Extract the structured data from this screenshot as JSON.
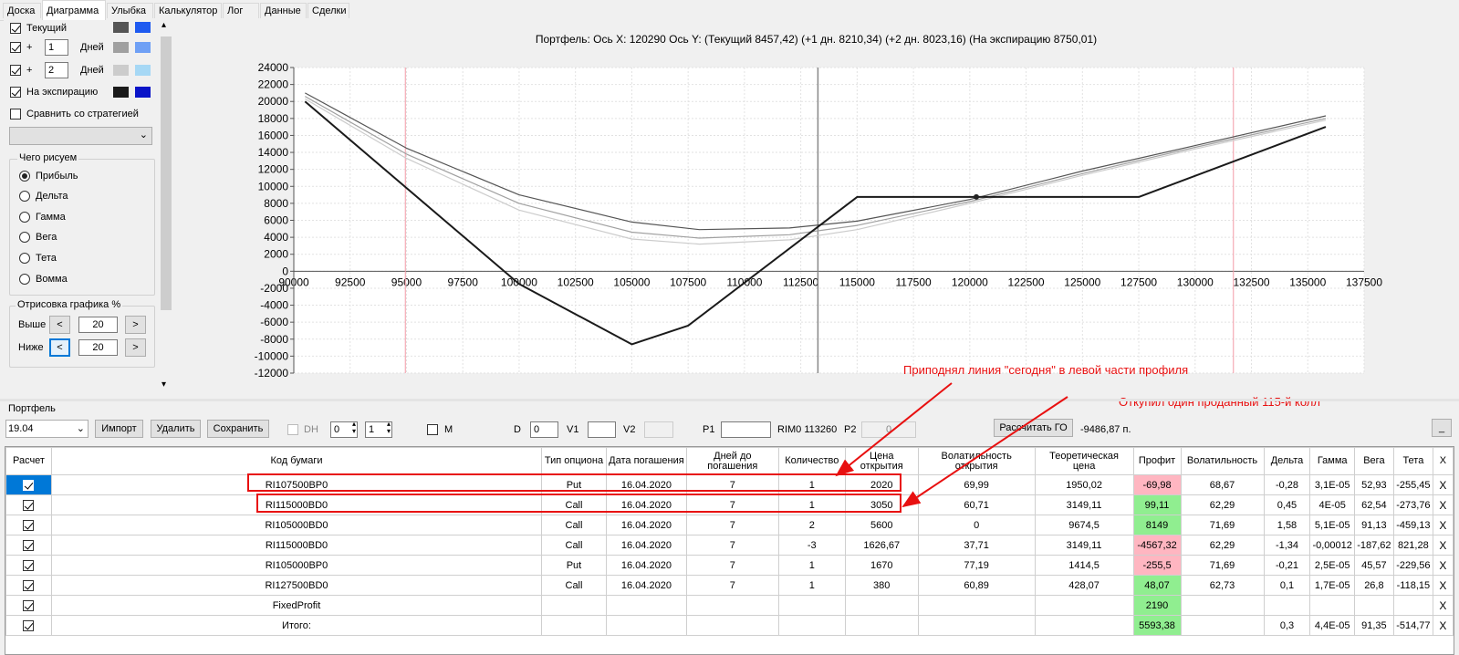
{
  "tabs": [
    "Доска",
    "Диаграмма",
    "Улыбка",
    "Калькулятор",
    "Лог",
    "Данные",
    "Сделки"
  ],
  "active_tab": 1,
  "left_panel": {
    "current_label": "Текущий",
    "plus1_sign": "+",
    "plus1_days": "1",
    "plus1_unit": "Дней",
    "plus2_sign": "+",
    "plus2_days": "2",
    "plus2_unit": "Дней",
    "expiry_label": "На экспирацию",
    "compare_label": "Сравнить со стратегией",
    "what_draw_title": "Чего рисуем",
    "radios": [
      "Прибыль",
      "Дельта",
      "Гамма",
      "Вега",
      "Тета",
      "Вомма"
    ],
    "selected_radio": 0,
    "render_title": "Отрисовка графика %",
    "above_label": "Выше",
    "above_value": "20",
    "below_label": "Ниже",
    "below_value": "20",
    "swatches": {
      "current": [
        "#555555",
        "#1e5af0"
      ],
      "plus1": [
        "#a0a0a0",
        "#6fa0f5"
      ],
      "plus2": [
        "#cccccc",
        "#a6d8f5"
      ],
      "expiry": [
        "#1a1a1a",
        "#0a14c8"
      ]
    }
  },
  "chart_header": "Портфель: Ось X: 120290 Ось Y:  (Текущий 8457,42)  (+1 дн. 8210,34)  (+2 дн. 8023,16)  (На экспирацию 8750,01)",
  "chart_data": {
    "type": "line",
    "xlim": [
      90000,
      137500
    ],
    "ylim": [
      -12000,
      24000
    ],
    "x_ticks": [
      "90000",
      "92500",
      "95000",
      "97500",
      "100000",
      "102500",
      "105000",
      "107500",
      "110000",
      "112500",
      "115000",
      "117500",
      "120000",
      "122500",
      "125000",
      "127500",
      "130000",
      "132500",
      "135000",
      "137500"
    ],
    "y_ticks": [
      "24000",
      "22000",
      "20000",
      "18000",
      "16000",
      "14000",
      "12000",
      "10000",
      "8000",
      "6000",
      "4000",
      "2000",
      "0",
      "-2000",
      "-4000",
      "-6000",
      "-8000",
      "-10000",
      "-12000"
    ],
    "grid": true,
    "cursor_x": 113260,
    "red_lines_x": [
      94950,
      131700
    ],
    "marker": {
      "x": 120290,
      "y": 8750
    },
    "series": [
      {
        "color": "#1a1a1a",
        "points": [
          [
            90500,
            20000
          ],
          [
            100000,
            -1500
          ],
          [
            105000,
            -8600
          ],
          [
            107500,
            -6400
          ],
          [
            115000,
            8750
          ],
          [
            127500,
            8750
          ],
          [
            135800,
            17000
          ]
        ]
      },
      {
        "color": "#555555",
        "points": [
          [
            90500,
            21000
          ],
          [
            95000,
            14500
          ],
          [
            100000,
            9000
          ],
          [
            105000,
            5800
          ],
          [
            108000,
            4900
          ],
          [
            112000,
            5100
          ],
          [
            115000,
            5900
          ],
          [
            120000,
            8450
          ],
          [
            125000,
            11800
          ],
          [
            130000,
            14800
          ],
          [
            135800,
            18300
          ]
        ]
      },
      {
        "color": "#a0a0a0",
        "points": [
          [
            90500,
            20600
          ],
          [
            95000,
            13800
          ],
          [
            100000,
            8000
          ],
          [
            105000,
            4600
          ],
          [
            108000,
            3900
          ],
          [
            112000,
            4300
          ],
          [
            115000,
            5400
          ],
          [
            120000,
            8200
          ],
          [
            125000,
            11500
          ],
          [
            130000,
            14600
          ],
          [
            135800,
            18000
          ]
        ]
      },
      {
        "color": "#cccccc",
        "points": [
          [
            90500,
            20300
          ],
          [
            95000,
            13300
          ],
          [
            100000,
            7200
          ],
          [
            105000,
            3800
          ],
          [
            108000,
            3200
          ],
          [
            112000,
            3700
          ],
          [
            115000,
            4900
          ],
          [
            120000,
            8000
          ],
          [
            125000,
            11300
          ],
          [
            130000,
            14400
          ],
          [
            135800,
            17800
          ]
        ]
      }
    ]
  },
  "annotations": {
    "today_line": "Приподнял линия \"сегодня\" в левой части профиля",
    "bought_call": "Откупил один проданный 115-й колл"
  },
  "portfolio": {
    "title": "Портфель",
    "portfolio_select": "19.04",
    "import": "Импорт",
    "delete": "Удалить",
    "save": "Сохранить",
    "dh_label": "DH",
    "dh_val1": "0",
    "dh_val2": "1",
    "m_label": "M",
    "d_label": "D",
    "d_value": "0",
    "v1_label": "V1",
    "v2_label": "V2",
    "p1_label": "P1",
    "rim_label": "RIM0 113260",
    "p2_label": "P2",
    "p2_value": "0",
    "calc_go": "Рассчитать ГО",
    "go_value": "-9486,87 п.",
    "underscore": "_"
  },
  "table": {
    "headers": [
      "Расчет",
      "Код бумаги",
      "Тип опциона",
      "Дата погашения",
      "Дней до погашения",
      "Количество",
      "Цена открытия",
      "Волатильность открытия",
      "Теоретическая цена",
      "Профит",
      "Волатильность",
      "Дельта",
      "Гамма",
      "Вега",
      "Тета",
      "X"
    ],
    "rows": [
      [
        "RI107500BP0",
        "Put",
        "16.04.2020",
        "7",
        "1",
        "2020",
        "69,99",
        "1950,02",
        "-69,98",
        "68,67",
        "-0,28",
        "3,1E-05",
        "52,93",
        "-255,45",
        "X"
      ],
      [
        "RI115000BD0",
        "Call",
        "16.04.2020",
        "7",
        "1",
        "3050",
        "60,71",
        "3149,11",
        "99,11",
        "62,29",
        "0,45",
        "4E-05",
        "62,54",
        "-273,76",
        "X"
      ],
      [
        "RI105000BD0",
        "Call",
        "16.04.2020",
        "7",
        "2",
        "5600",
        "0",
        "9674,5",
        "8149",
        "71,69",
        "1,58",
        "5,1E-05",
        "91,13",
        "-459,13",
        "X"
      ],
      [
        "RI115000BD0",
        "Call",
        "16.04.2020",
        "7",
        "-3",
        "1626,67",
        "37,71",
        "3149,11",
        "-4567,32",
        "62,29",
        "-1,34",
        "-0,00012",
        "-187,62",
        "821,28",
        "X"
      ],
      [
        "RI105000BP0",
        "Put",
        "16.04.2020",
        "7",
        "1",
        "1670",
        "77,19",
        "1414,5",
        "-255,5",
        "71,69",
        "-0,21",
        "2,5E-05",
        "45,57",
        "-229,56",
        "X"
      ],
      [
        "RI127500BD0",
        "Call",
        "16.04.2020",
        "7",
        "1",
        "380",
        "60,89",
        "428,07",
        "48,07",
        "62,73",
        "0,1",
        "1,7E-05",
        "26,8",
        "-118,15",
        "X"
      ],
      [
        "FixedProfit",
        "",
        "",
        "",
        "",
        "",
        "",
        "",
        "2190",
        "",
        "",
        "",
        "",
        "",
        "X"
      ],
      [
        "Итого:",
        "",
        "",
        "",
        "",
        "",
        "",
        "",
        "5593,38",
        "",
        "0,3",
        "4,4E-05",
        "91,35",
        "-514,77",
        "X"
      ]
    ],
    "profit_sign": [
      "neg",
      "pos",
      "pos",
      "neg",
      "neg",
      "pos",
      "pos",
      "pos"
    ]
  }
}
